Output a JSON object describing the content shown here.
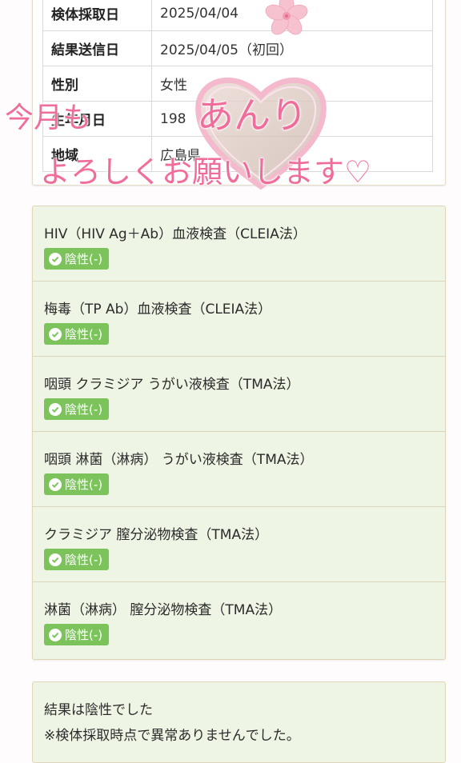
{
  "info": {
    "rows": [
      {
        "label": "検体採取日",
        "value": "2025/04/04"
      },
      {
        "label": "結果送信日",
        "value": "2025/04/05（初回）"
      },
      {
        "label": "性別",
        "value": "女性"
      },
      {
        "label": "生年月日",
        "value": "198"
      },
      {
        "label": "地域",
        "value": "広島県"
      }
    ]
  },
  "results": [
    {
      "title": "HIV（HIV Ag＋Ab）血液検査（CLEIA法）",
      "status": "陰性(-)"
    },
    {
      "title": "梅毒（TP Ab）血液検査（CLEIA法）",
      "status": "陰性(-)"
    },
    {
      "title": "咽頭 クラミジア うがい液検査（TMA法）",
      "status": "陰性(-)"
    },
    {
      "title": "咽頭 淋菌（淋病） うがい液検査（TMA法）",
      "status": "陰性(-)"
    },
    {
      "title": "クラミジア 膣分泌物検査（TMA法）",
      "status": "陰性(-)"
    },
    {
      "title": "淋菌（淋病） 膣分泌物検査（TMA法）",
      "status": "陰性(-)"
    }
  ],
  "summary": {
    "line1": "結果は陰性でした",
    "line2": "※検体採取時点で異常ありませんでした。"
  },
  "overlay": {
    "text1": "今月も",
    "name": "あんり",
    "text2": "よろしくお願いします♡"
  },
  "colors": {
    "badge": "#7cc35c",
    "card_bg": "#eef5e4",
    "overlay_pink": "#f06d9b"
  }
}
